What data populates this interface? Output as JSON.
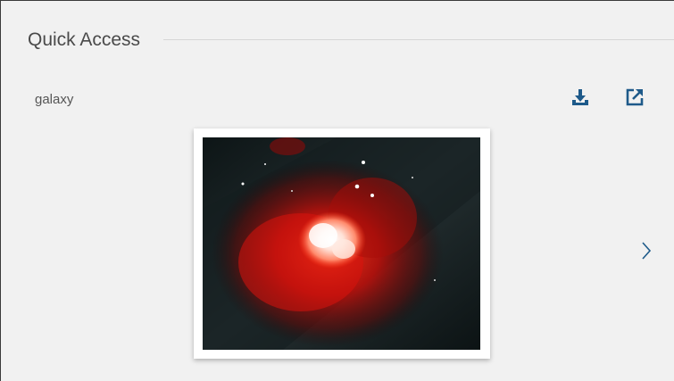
{
  "section": {
    "title": "Quick Access"
  },
  "item": {
    "title": "galaxy",
    "image_alt": "galaxy"
  },
  "actions": {
    "download_icon": "download-icon",
    "open_external_icon": "open-external-icon",
    "next_icon": "chevron-right-icon"
  },
  "colors": {
    "accent": "#1e5a8a",
    "background": "#f1f1f1",
    "title_text": "#4a4a4a"
  }
}
